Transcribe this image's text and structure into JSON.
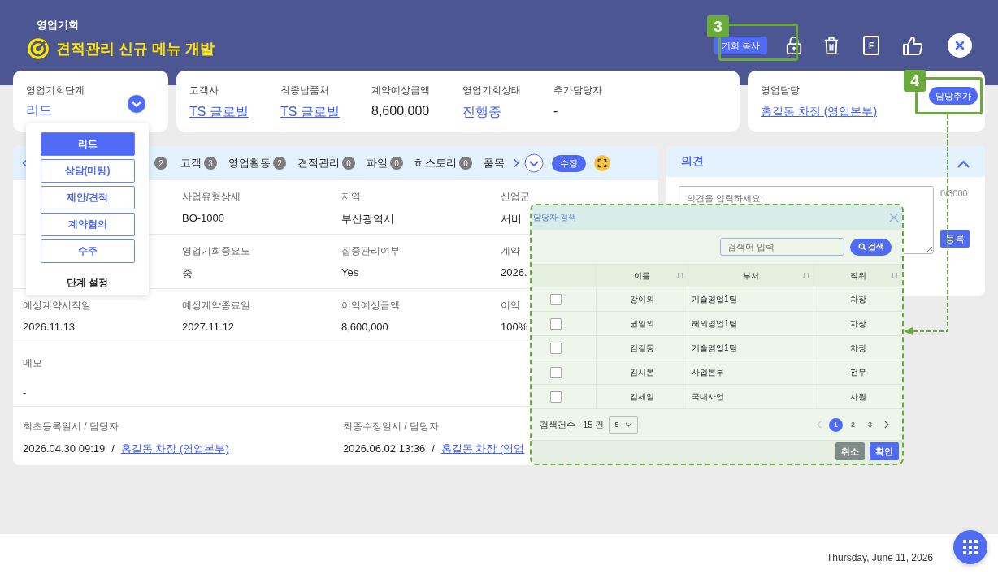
{
  "header": {
    "section": "영업기회",
    "title": "견적관리 신규 메뉴 개발",
    "copy_button": "기회 복사",
    "actions": [
      {
        "kind": "lock"
      },
      {
        "kind": "trash"
      },
      {
        "kind": "file",
        "letter": "F"
      },
      {
        "kind": "like"
      },
      {
        "kind": "close"
      }
    ]
  },
  "annotations": [
    {
      "label": "3"
    },
    {
      "label": "4"
    }
  ],
  "stage": {
    "label": "영업기회단계",
    "value": "리드",
    "options": [
      {
        "label": "리드",
        "selected": true
      },
      {
        "label": "상담(미팅)",
        "selected": false
      },
      {
        "label": "제안/견적",
        "selected": false
      },
      {
        "label": "계약협의",
        "selected": false
      },
      {
        "label": "수주",
        "selected": false
      }
    ],
    "settings": "단계 설정"
  },
  "summary": [
    {
      "label": "고객사",
      "value": "TS 글로벌",
      "kind": "link"
    },
    {
      "label": "최종납품처",
      "value": "TS 글로벌",
      "kind": "link"
    },
    {
      "label": "계약예상금액",
      "value": "8,600,000",
      "kind": "plain"
    },
    {
      "label": "영업기회상태",
      "value": "진행중",
      "kind": "accent"
    },
    {
      "label": "추가담당자",
      "value": "-",
      "kind": "plain"
    }
  ],
  "owner": {
    "label": "영업담당",
    "value": "홍길동 차장 (영업본부)",
    "button": "담당추가"
  },
  "tabs": [
    {
      "count": "2"
    },
    {
      "label": "고객",
      "count": "3"
    },
    {
      "label": "영업활동",
      "count": "2"
    },
    {
      "label": "견적관리",
      "count": "0"
    },
    {
      "label": "파일",
      "count": "0"
    },
    {
      "label": "히스토리",
      "count": "0"
    },
    {
      "label": "품목"
    }
  ],
  "edit_button": "수정",
  "details": [
    {
      "kind": "grid",
      "cells": [
        {
          "label": "사업유형상세",
          "value": "BO-1000"
        },
        {
          "label": "지역",
          "value": "부산광역시"
        },
        {
          "label": "산업군",
          "value": "서비"
        }
      ]
    },
    {
      "kind": "grid",
      "cells": [
        {
          "label": "영업기회중요도",
          "value": "중"
        },
        {
          "label": "집중관리여부",
          "value": "Yes"
        },
        {
          "label": "계약",
          "value": "2026."
        }
      ]
    },
    {
      "kind": "grid",
      "cells": [
        {
          "label": "예상계약시작일",
          "value": "2026.11.13"
        },
        {
          "label": "예상계약종료일",
          "value": "2027.11.12"
        },
        {
          "label": "이익예상금액",
          "value": "8,600,000"
        },
        {
          "label": "이익",
          "value": "100%"
        }
      ]
    },
    {
      "kind": "memo",
      "label": "메모",
      "value": "-"
    },
    {
      "kind": "audit",
      "entries": [
        {
          "label": "최초등록일시 / 담당자",
          "time": "2026.04.30 09:19",
          "separator": "/",
          "user": "홍길동 차장 (영업본부)"
        },
        {
          "label": "최종수정일시 / 담당자",
          "time": "2026.06.02 13:36",
          "separator": "/",
          "user": "홍길동 차장 (영업"
        }
      ]
    }
  ],
  "opinion": {
    "title": "의견",
    "expanded": true,
    "placeholder": "의견을 입력하세요.",
    "counter": "0/3000",
    "submit": "등록"
  },
  "modal": {
    "title": "담당자 검색",
    "search_placeholder": "검색어 입력",
    "search_button": "검색",
    "columns": [
      {
        "label": "이름"
      },
      {
        "label": "부서"
      },
      {
        "label": "직위"
      }
    ],
    "rows": [
      {
        "checked": false,
        "name": "강이외",
        "dept": "기술영업1팀",
        "position": "차장"
      },
      {
        "checked": false,
        "name": "권일외",
        "dept": "해외영업1팀",
        "position": "차장"
      },
      {
        "checked": false,
        "name": "김길동",
        "dept": "기술영업1팀",
        "position": "차장"
      },
      {
        "checked": false,
        "name": "김시본",
        "dept": "사업본부",
        "position": "전무"
      },
      {
        "checked": false,
        "name": "김세일",
        "dept": "국내사업",
        "position": "사원"
      }
    ],
    "count_label": "검색건수 : 15 건",
    "page_size": "5",
    "pages": [
      {
        "label": "1",
        "selected": true
      },
      {
        "label": "2",
        "selected": false
      },
      {
        "label": "3",
        "selected": false
      }
    ],
    "buttons": [
      {
        "label": "취소",
        "kind": "secondary"
      },
      {
        "label": "확인",
        "kind": "primary"
      }
    ]
  },
  "footer": {
    "date": "Thursday, June 11, 2026"
  }
}
